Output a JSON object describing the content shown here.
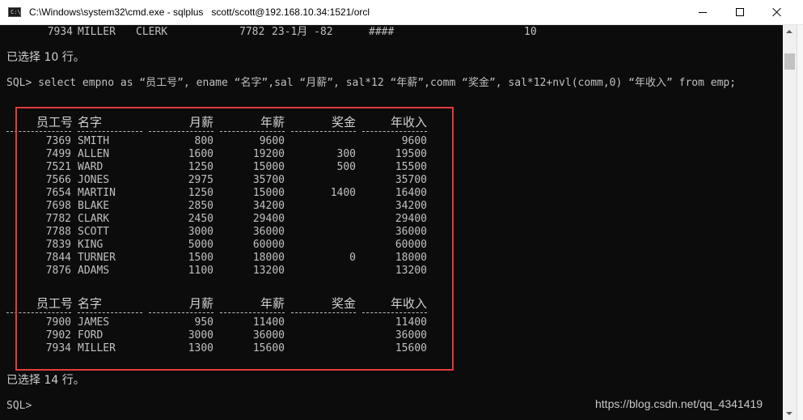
{
  "window": {
    "title": "C:\\Windows\\system32\\cmd.exe - sqlplus   scott/scott@192.168.10.34:1521/orcl",
    "icon_text": "C:\\"
  },
  "console": {
    "prev_row": {
      "empno": "7934",
      "ename": "MILLER",
      "job": "CLERK",
      "mgr": "7782",
      "hiredate": "23-1月 -82",
      "sal": "####",
      "deptno": "10"
    },
    "prev_status": "已选择 10 行。",
    "command": "SQL> select empno as “员工号”, ename “名字”,sal “月薪”, sal*12 “年薪”,comm “奖金”, sal*12+nvl(comm,0) “年收入” from emp;",
    "headers": [
      "员工号",
      "名字",
      "月薪",
      "年薪",
      "奖金",
      "年收入"
    ],
    "page1": [
      [
        "7369",
        "SMITH",
        "800",
        "9600",
        "",
        "9600"
      ],
      [
        "7499",
        "ALLEN",
        "1600",
        "19200",
        "300",
        "19500"
      ],
      [
        "7521",
        "WARD",
        "1250",
        "15000",
        "500",
        "15500"
      ],
      [
        "7566",
        "JONES",
        "2975",
        "35700",
        "",
        "35700"
      ],
      [
        "7654",
        "MARTIN",
        "1250",
        "15000",
        "1400",
        "16400"
      ],
      [
        "7698",
        "BLAKE",
        "2850",
        "34200",
        "",
        "34200"
      ],
      [
        "7782",
        "CLARK",
        "2450",
        "29400",
        "",
        "29400"
      ],
      [
        "7788",
        "SCOTT",
        "3000",
        "36000",
        "",
        "36000"
      ],
      [
        "7839",
        "KING",
        "5000",
        "60000",
        "",
        "60000"
      ],
      [
        "7844",
        "TURNER",
        "1500",
        "18000",
        "0",
        "18000"
      ],
      [
        "7876",
        "ADAMS",
        "1100",
        "13200",
        "",
        "13200"
      ]
    ],
    "page2": [
      [
        "7900",
        "JAMES",
        "950",
        "11400",
        "",
        "11400"
      ],
      [
        "7902",
        "FORD",
        "3000",
        "36000",
        "",
        "36000"
      ],
      [
        "7934",
        "MILLER",
        "1300",
        "15600",
        "",
        "15600"
      ]
    ],
    "status": "已选择 14 行。",
    "prompt": "SQL>"
  },
  "watermark": "https://blog.csdn.net/qq_4341419",
  "colors": {
    "console_bg": "#0c0c0c",
    "console_text": "#c0c0c0",
    "highlight": "#e03c3c"
  }
}
